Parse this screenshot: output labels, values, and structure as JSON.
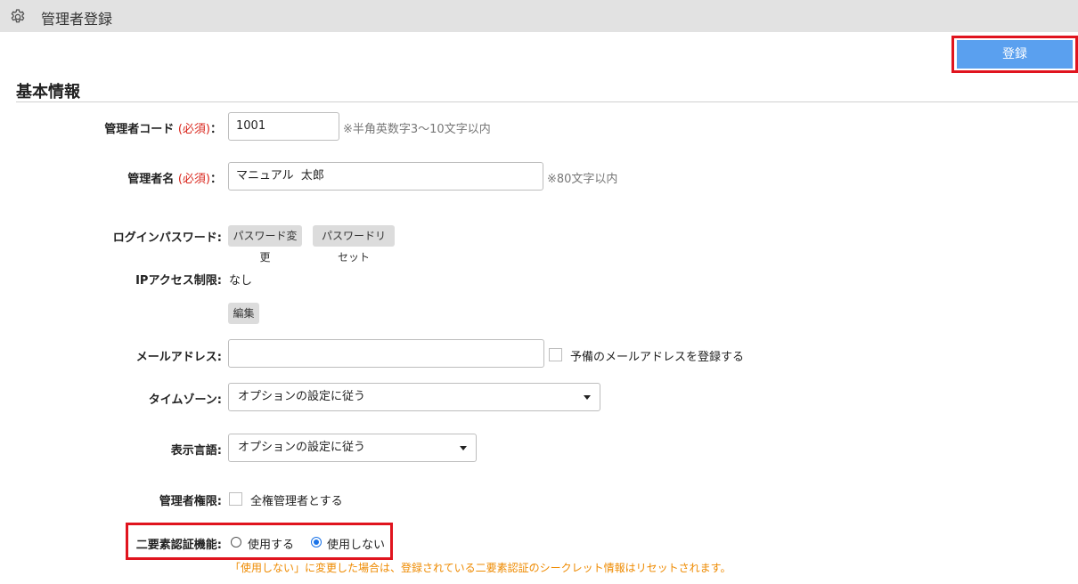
{
  "header": {
    "title": "管理者登録",
    "icon": "gear-icon"
  },
  "toolbar": {
    "register_label": "登録"
  },
  "section": {
    "title": "基本情報"
  },
  "form": {
    "code": {
      "label": "管理者コード",
      "required": "(必須)",
      "colon": "：",
      "value": "1001",
      "hint": "※半角英数字3～10文字以内"
    },
    "name": {
      "label": "管理者名",
      "required": "(必須)",
      "colon": "：",
      "value": "マニュアル  太郎",
      "hint": "※80文字以内"
    },
    "password": {
      "label": "ログインパスワード:",
      "change_button": "パスワード変更",
      "reset_button": "パスワードリセット"
    },
    "ip": {
      "label": "IPアクセス制限:",
      "value": "なし",
      "edit_button": "編集"
    },
    "email": {
      "label": "メールアドレス:",
      "value": "",
      "backup_label": "予備のメールアドレスを登録する"
    },
    "timezone": {
      "label": "タイムゾーン:",
      "selected": "オプションの設定に従う"
    },
    "language": {
      "label": "表示言語:",
      "selected": "オプションの設定に従う"
    },
    "permission": {
      "label": "管理者権限:",
      "checkbox_label": "全権管理者とする"
    },
    "twofa": {
      "label": "二要素認証機能:",
      "options": [
        {
          "label": "使用する",
          "selected": false
        },
        {
          "label": "使用しない",
          "selected": true
        }
      ],
      "warning": "「使用しない」に変更した場合は、登録されている二要素認証のシークレット情報はリセットされます。"
    }
  },
  "colors": {
    "accent": "#5aa0ef",
    "highlight": "#e0141e",
    "required": "#d9261c",
    "warning": "#ee8a00",
    "radio": "#1a73e8"
  }
}
